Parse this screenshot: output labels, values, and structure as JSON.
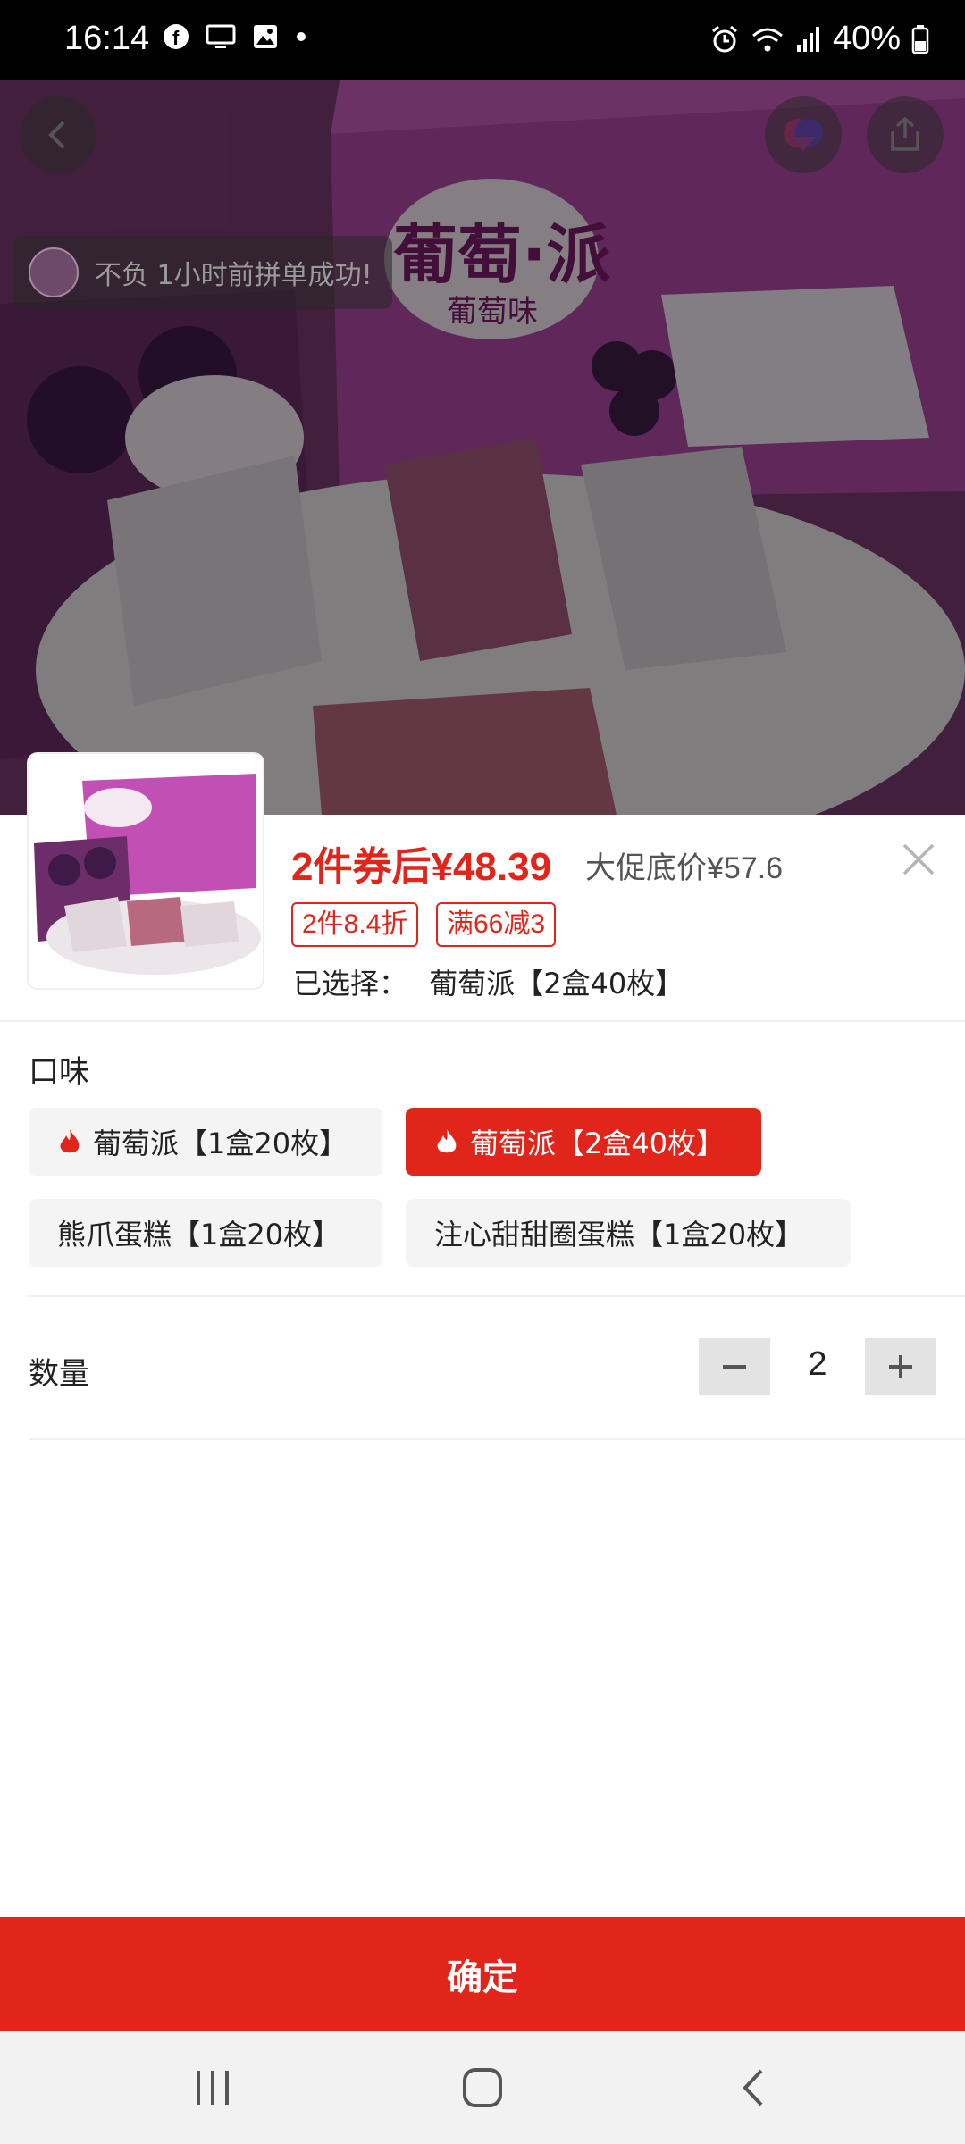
{
  "status_bar": {
    "time": "16:14",
    "battery": "40%",
    "left_icons": [
      "facebook-icon",
      "screen-cast-icon",
      "gallery-icon",
      "dot-icon"
    ],
    "right_icons": [
      "alarm-icon",
      "wifi-icon",
      "signal-icon",
      "battery-icon"
    ]
  },
  "hero": {
    "toast_text": "不负 1小时前拼单成功!",
    "product_labels": [
      "葡萄·派",
      "葡萄味"
    ]
  },
  "product": {
    "price_main": "2件券后¥48.39",
    "price_sub": "大促底价¥57.6",
    "tags": [
      "2件8.4折",
      "满66减3"
    ],
    "selected_label": "已选择：",
    "selected_value": "葡萄派【2盒40枚】"
  },
  "flavor": {
    "label": "口味",
    "options": [
      {
        "label": "葡萄派【1盒20枚】",
        "hot": true,
        "selected": false
      },
      {
        "label": "葡萄派【2盒40枚】",
        "hot": true,
        "selected": true
      },
      {
        "label": "熊爪蛋糕【1盒20枚】",
        "hot": false,
        "selected": false
      },
      {
        "label": "注心甜甜圈蛋糕【1盒20枚】",
        "hot": false,
        "selected": false
      }
    ]
  },
  "quantity": {
    "label": "数量",
    "value": "2",
    "minus": "−",
    "plus": "+"
  },
  "confirm_label": "确定",
  "colors": {
    "accent": "#e1251b",
    "option_bg": "#f4f4f4"
  }
}
